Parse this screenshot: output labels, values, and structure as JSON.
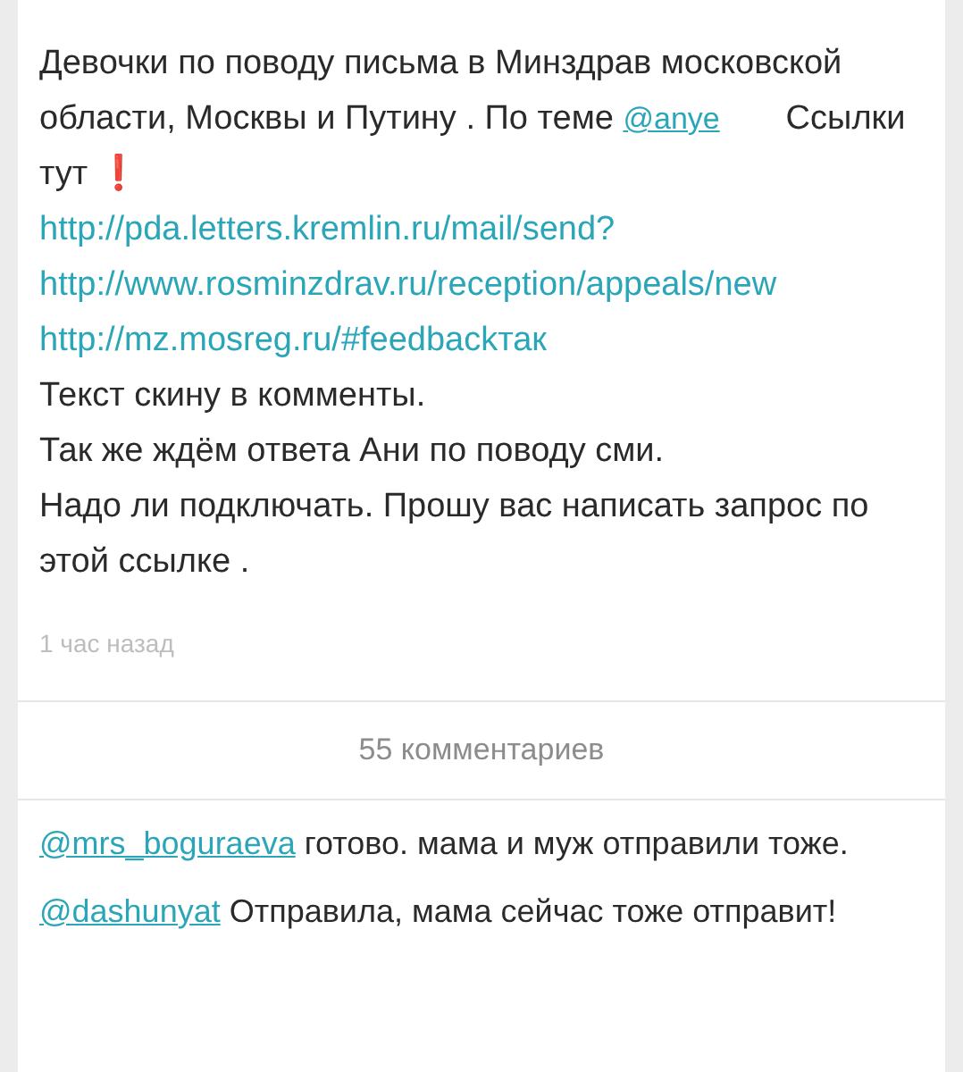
{
  "post": {
    "paragraphs": [
      [
        {
          "kind": "text",
          "text": "Девочки по поводу письма в Минздрав московской области, Москвы и Путину . По теме "
        },
        {
          "kind": "mention",
          "text": "@anye"
        },
        {
          "kind": "text",
          "text": "       Ссылки тут "
        },
        {
          "kind": "emoji",
          "text": "❗"
        }
      ],
      [
        {
          "kind": "link",
          "text": "http://pda.letters.kremlin.ru/mail/send?"
        }
      ],
      [
        {
          "kind": "link",
          "text": "http://www.rosminzdrav.ru/reception/appeals/new"
        }
      ],
      [
        {
          "kind": "link",
          "text": "http://mz.mosreg.ru/#feedbackтак"
        }
      ],
      [
        {
          "kind": "text",
          "text": "Текст скину в комменты."
        }
      ],
      [
        {
          "kind": "text",
          "text": "Так же ждём ответа Ани по поводу сми."
        }
      ],
      [
        {
          "kind": "text",
          "text": "Надо ли подключать. Прошу вас написать запрос по этой ссылке ."
        }
      ]
    ],
    "time": "1 час назад"
  },
  "comments_count": "55 комментариев",
  "comments": [
    {
      "author": "@mrs_boguraeva",
      "text": "готово. мама и муж отправили тоже."
    },
    {
      "author": "@dashunyat",
      "text": "Отправила, мама сейчас тоже отправит!"
    }
  ]
}
